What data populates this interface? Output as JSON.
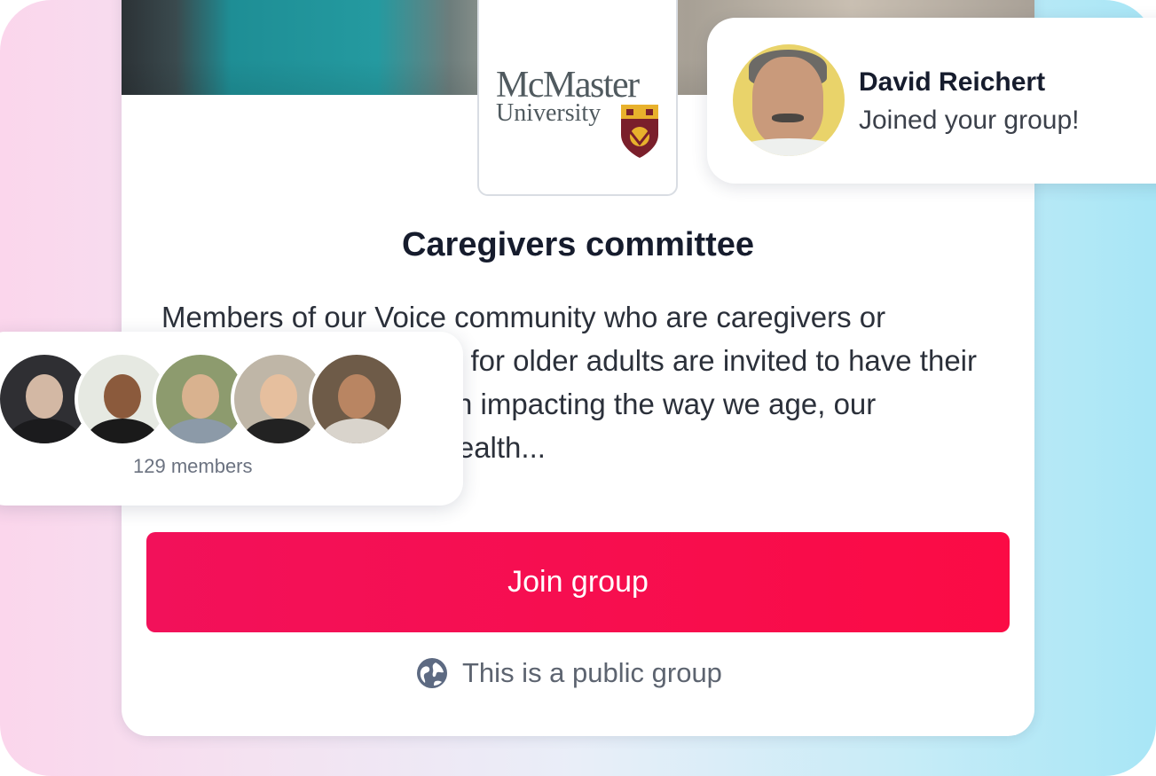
{
  "brand": {
    "logo_name": "McMaster",
    "logo_subtitle": "University"
  },
  "group": {
    "title": "Caregivers committee",
    "description": "Members of our Voice community who are caregivers or professional caregivers for older adults are invited to have their say about new research impacting the way we age, our communities and our health...",
    "join_label": "Join group",
    "visibility_label": "This is a public group",
    "visibility_icon": "globe-icon"
  },
  "members": {
    "count_label": "129 members",
    "avatars": [
      "member-avatar",
      "member-avatar",
      "member-avatar",
      "member-avatar",
      "member-avatar"
    ]
  },
  "notification": {
    "name": "David Reichert",
    "message": "Joined your group!"
  },
  "colors": {
    "accent": "#fb0b45",
    "title": "#161c2d",
    "muted": "#6b7280",
    "logo_gold": "#e8b12c",
    "logo_maroon": "#7a1f2b"
  }
}
